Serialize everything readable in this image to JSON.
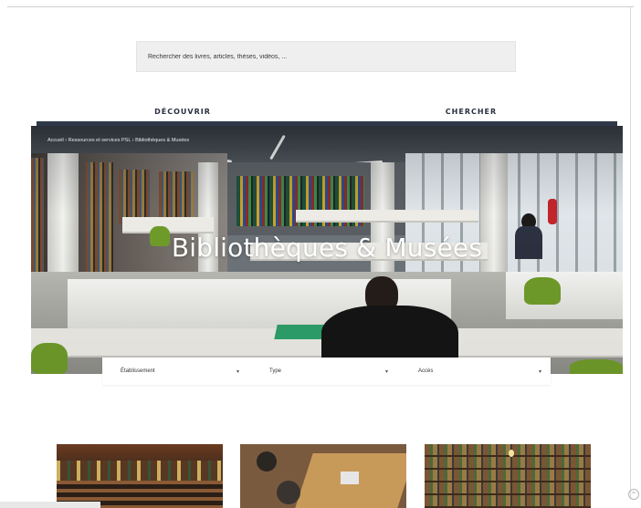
{
  "search": {
    "placeholder": "Rechercher des livres, articles, thèses, vidéos, ..."
  },
  "nav": {
    "discover_label": "DÉCOUVRIR",
    "search_label": "CHERCHER"
  },
  "hero": {
    "breadcrumb": "Accueil › Ressources et services PSL › Bibliothèques & Musées",
    "title": "Bibliothèques & Musées"
  },
  "filters": [
    {
      "label": "Établissement"
    },
    {
      "label": "Type"
    },
    {
      "label": "Accès"
    }
  ],
  "icons": {
    "chevron": "chevron-down-icon",
    "corner": "scroll-top-icon"
  },
  "colors": {
    "nav_bar": "#2f3848",
    "search_bg": "#efefef",
    "hero_title": "#ffffff"
  }
}
